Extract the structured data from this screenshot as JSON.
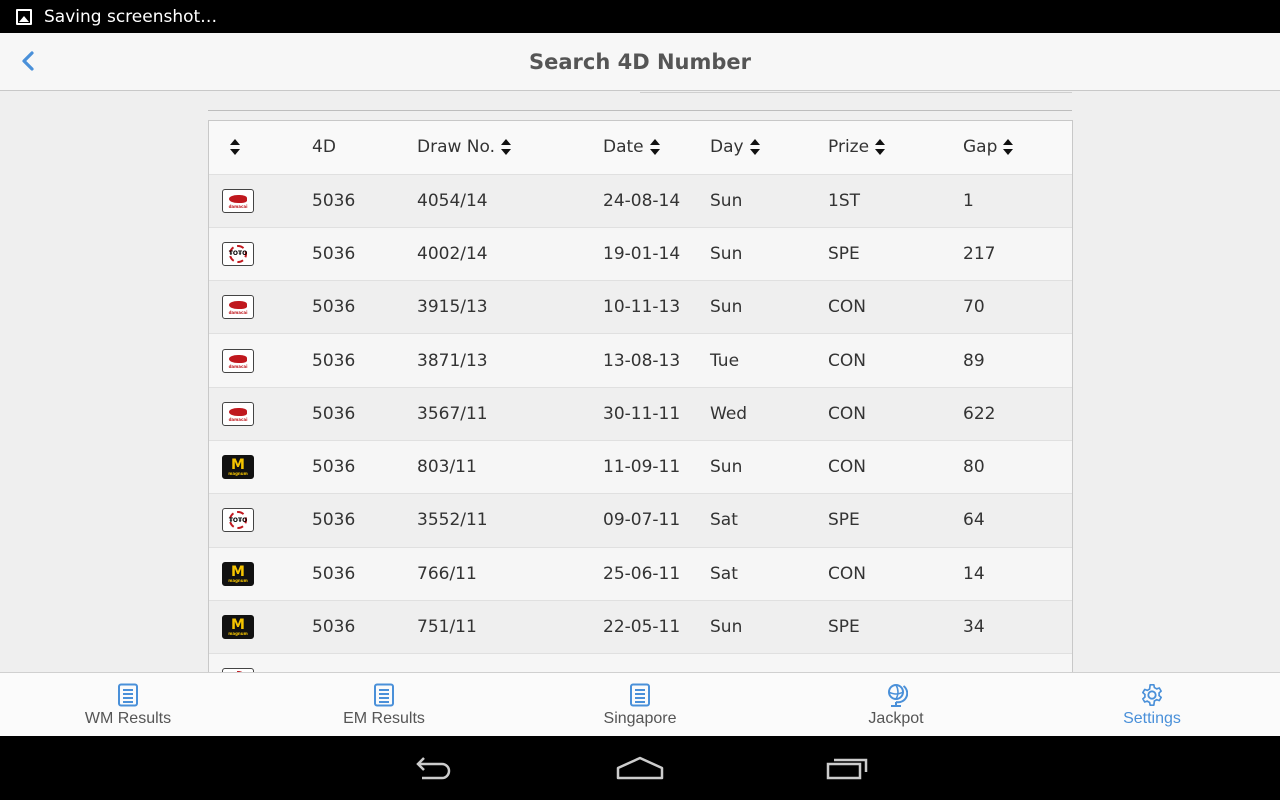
{
  "statusbar": {
    "notification": "Saving screenshot…"
  },
  "appbar": {
    "title": "Search 4D Number"
  },
  "table": {
    "headers": [
      "",
      "4D",
      "Draw No.",
      "Date",
      "Day",
      "Prize",
      "Gap"
    ],
    "rows": [
      {
        "operator": "damacai",
        "number": "5036",
        "draw": "4054/14",
        "date": "24-08-14",
        "day": "Sun",
        "prize": "1ST",
        "gap": "1"
      },
      {
        "operator": "toto",
        "number": "5036",
        "draw": "4002/14",
        "date": "19-01-14",
        "day": "Sun",
        "prize": "SPE",
        "gap": "217"
      },
      {
        "operator": "damacai",
        "number": "5036",
        "draw": "3915/13",
        "date": "10-11-13",
        "day": "Sun",
        "prize": "CON",
        "gap": "70"
      },
      {
        "operator": "damacai",
        "number": "5036",
        "draw": "3871/13",
        "date": "13-08-13",
        "day": "Tue",
        "prize": "CON",
        "gap": "89"
      },
      {
        "operator": "damacai",
        "number": "5036",
        "draw": "3567/11",
        "date": "30-11-11",
        "day": "Wed",
        "prize": "CON",
        "gap": "622"
      },
      {
        "operator": "magnum",
        "number": "5036",
        "draw": "803/11",
        "date": "11-09-11",
        "day": "Sun",
        "prize": "CON",
        "gap": "80"
      },
      {
        "operator": "toto",
        "number": "5036",
        "draw": "3552/11",
        "date": "09-07-11",
        "day": "Sat",
        "prize": "SPE",
        "gap": "64"
      },
      {
        "operator": "magnum",
        "number": "5036",
        "draw": "766/11",
        "date": "25-06-11",
        "day": "Sat",
        "prize": "CON",
        "gap": "14"
      },
      {
        "operator": "magnum",
        "number": "5036",
        "draw": "751/11",
        "date": "22-05-11",
        "day": "Sun",
        "prize": "SPE",
        "gap": "34"
      },
      {
        "operator": "toto",
        "number": "",
        "draw": "",
        "date": "",
        "day": "",
        "prize": "",
        "gap": ""
      }
    ]
  },
  "bottomnav": {
    "items": [
      {
        "label": "WM Results",
        "icon": "document-icon",
        "active": false
      },
      {
        "label": "EM Results",
        "icon": "document-icon",
        "active": false
      },
      {
        "label": "Singapore",
        "icon": "document-icon",
        "active": false
      },
      {
        "label": "Jackpot",
        "icon": "globe-icon",
        "active": false
      },
      {
        "label": "Settings",
        "icon": "gear-icon",
        "active": true
      }
    ]
  },
  "colors": {
    "accent": "#4a90d9",
    "statusbar": "#000000",
    "damacai": "#c0181e",
    "magnum": "#f5c400"
  }
}
